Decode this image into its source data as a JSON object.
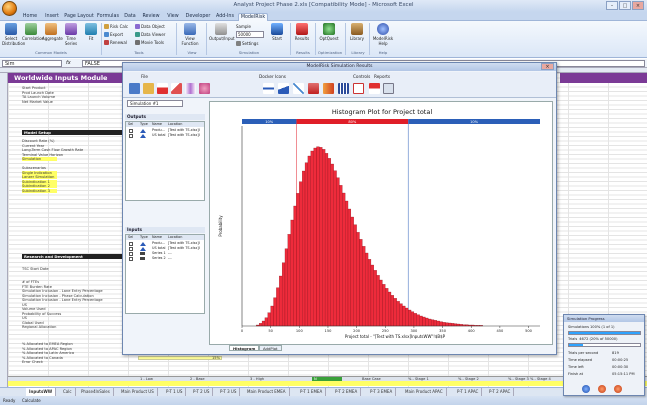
{
  "window": {
    "title": "Analyst Project Phase 2.xls [Compatibility Mode] - Microsoft Excel"
  },
  "ribbon_tabs": [
    "Home",
    "Insert",
    "Page Layout",
    "Formulas",
    "Data",
    "Review",
    "View",
    "Developer",
    "Add-Ins",
    "ModelRisk"
  ],
  "ribbon": {
    "buttons": [
      "Select Distribution",
      "Correlation",
      "Aggregate",
      "Time Series",
      "Fit",
      "View Function",
      "Output/Input",
      "Start",
      "Results",
      "OptQuest",
      "Library",
      "ModelRisk Help"
    ],
    "small": [
      "Risk Calc",
      "Export",
      "Renewal",
      "Data Object",
      "Data Viewer",
      "Movie Tools",
      "Sample",
      "Settings"
    ],
    "sample_value": "50000",
    "groups": [
      "Common Models",
      "Tools",
      "View",
      "Simulation",
      "Results",
      "Optimization",
      "Library",
      "Help"
    ]
  },
  "formula_bar": {
    "name_box": "Sim",
    "value": "FALSE"
  },
  "sheet": {
    "module_title": "Worldwide Inputs Module",
    "rows_top": [
      "Start Product",
      "Prod Launch Date",
      "TA Launch Volume",
      "Net Market Value"
    ],
    "model_setup": "Model Setup",
    "rows_setup": [
      "Discount Rate (%)",
      "Current Year",
      "Long-Term Cash Flow Growth Rate",
      "Terminal Value Horizon",
      "Simulation",
      "Subscenarios",
      "Single Indication",
      "Lanzer Simulation",
      "Subindication 1",
      "Subindication 2",
      "Subindication 3"
    ],
    "rnd": "Research and Development",
    "rows_rnd": [
      "TSC Start Date",
      "# of FTEs",
      "FTE Burden Rate",
      "Simulation Inclusion - Lane Entry Percentage",
      "Simulation Inclusion - Phase Calculation",
      "Simulation Inclusion - Lane Entry Percentage",
      "US",
      "Volume Used",
      "Probability of Success",
      "US",
      "Global Used",
      "Regional Allocation",
      "% Allocated to EMEA Region",
      "% Allocated to APAC Region",
      "% Allocated to Latin America",
      "% Allocated to Canada",
      "Error Check"
    ],
    "pct": [
      "20%",
      "35%",
      "30%",
      "15%",
      "100%"
    ],
    "bottom_row": [
      "1 - Low",
      "2 - Base",
      "3 - High",
      "N",
      "Base Case",
      "% - Stage 1",
      "% - Stage 2",
      "% - Stage 3",
      "% - Stage 4"
    ]
  },
  "sheet_tabs": [
    "InputsWW",
    "Calc",
    "Phase4InSales",
    "Main Product US",
    "P-T 1 US",
    "P-T 2 US",
    "P-T 3 US",
    "Main Product EMEA",
    "P-T 1 EMEA",
    "P-T 2 EMEA",
    "P-T 3 EMEA",
    "Main Product APAC",
    "P-T 1 APAC",
    "P-T 2 APAC"
  ],
  "status": {
    "left": "Ready",
    "right": "Calculate"
  },
  "dialog": {
    "title": "ModelRisk Simulation Results",
    "menu": [
      "File",
      "Docker Icons",
      "Controls",
      "Reports"
    ],
    "simulation_select": "Simulation #1",
    "outputs_header": "Outputs",
    "inputs_header": "Inputs",
    "grid_cols": [
      "Sel",
      "Type",
      "Name",
      "Location"
    ],
    "outputs": [
      {
        "name": "Produ...",
        "loc": "[Test with TS.xlsx]I"
      },
      {
        "name": "US total",
        "loc": "[Test with TS.xlsx]I"
      }
    ],
    "inputs": [
      {
        "name": "Produ...",
        "loc": "[Test with TS.xlsx]I"
      },
      {
        "name": "US total",
        "loc": "[Test with TS.xlsx]I"
      },
      {
        "name": "Series 1",
        "loc": "---"
      },
      {
        "name": "Series 2",
        "loc": "---"
      }
    ],
    "plot_tabs": [
      "Histogram",
      "AddPlot"
    ]
  },
  "chart_data": {
    "type": "bar",
    "title": "Histogram Plot for Project total",
    "xlabel": "Project total - \"[Test with TS.xlsx]InputsWW\"!$B$P",
    "ylabel": "Probability",
    "xlim": [
      0,
      520
    ],
    "ylim": [
      0,
      0.06
    ],
    "xticks": [
      0,
      50,
      100,
      150,
      200,
      250,
      300,
      350,
      400,
      450,
      500
    ],
    "bin_width": 5,
    "x_start": 25,
    "values": [
      0.0003,
      0.0008,
      0.0015,
      0.0025,
      0.004,
      0.006,
      0.0085,
      0.0115,
      0.015,
      0.019,
      0.0232,
      0.0275,
      0.0318,
      0.036,
      0.0398,
      0.0433,
      0.0465,
      0.049,
      0.051,
      0.0525,
      0.0534,
      0.0538,
      0.0536,
      0.053,
      0.0518,
      0.0503,
      0.0486,
      0.0466,
      0.0445,
      0.0422,
      0.0399,
      0.0375,
      0.0351,
      0.0327,
      0.0304,
      0.0281,
      0.026,
      0.0239,
      0.0219,
      0.02,
      0.0183,
      0.0167,
      0.0152,
      0.0138,
      0.0125,
      0.0113,
      0.0102,
      0.0092,
      0.0083,
      0.0074,
      0.0067,
      0.006,
      0.0054,
      0.0048,
      0.0043,
      0.0038,
      0.0034,
      0.003,
      0.0027,
      0.0024,
      0.0021,
      0.0019,
      0.0017,
      0.0015,
      0.0013,
      0.0011,
      0.001,
      0.0009,
      0.0008,
      0.0007,
      0.0006,
      0.0005,
      0.0004,
      0.0004,
      0.0003,
      0.0003,
      0.0002,
      0.0002,
      0.0002
    ],
    "percentile_bands": [
      {
        "label": "10%",
        "from": 0,
        "to": 95
      },
      {
        "label": "80%",
        "from": 95,
        "to": 290
      },
      {
        "label": "10%",
        "from": 290,
        "to": 520
      }
    ],
    "colors": {
      "bar": "#ee2b3b",
      "band": "#2b5fb8",
      "band_mid": "#e01e28"
    }
  },
  "progress": {
    "title": "Simulation Progress",
    "sims_label": "Simulations",
    "sims_value": "100% (1 of 1)",
    "trials_label": "Trials",
    "trials_value": "4672 (20% of 50000)",
    "trials_fraction": 0.2,
    "rows": [
      [
        "Trials per second",
        "819"
      ],
      [
        "Time elapsed",
        "00:00:25"
      ],
      [
        "Time left",
        "00:00:30"
      ],
      [
        "Finish at",
        "05:15:11 PM"
      ]
    ]
  }
}
